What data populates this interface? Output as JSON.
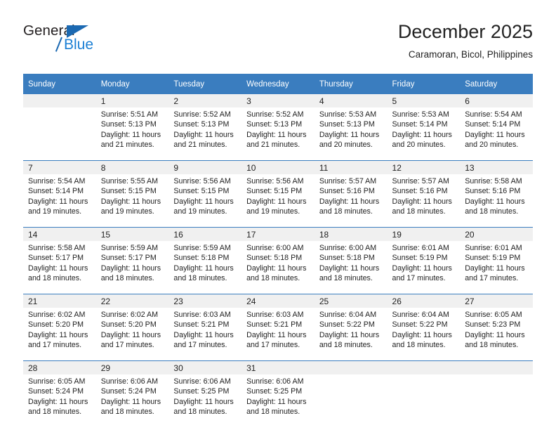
{
  "logo": {
    "text_primary": "General",
    "text_secondary": "Blue",
    "primary_color": "#231f20",
    "secondary_color": "#1b7fd4",
    "triangle_color": "#1b69b2"
  },
  "header": {
    "title": "December 2025",
    "subtitle": "Caramoran, Bicol, Philippines"
  },
  "calendar": {
    "header_bg": "#3a7dbf",
    "day_row_bg": "#f0f0f0",
    "weekdays": [
      "Sunday",
      "Monday",
      "Tuesday",
      "Wednesday",
      "Thursday",
      "Friday",
      "Saturday"
    ],
    "weeks": [
      [
        {
          "day": ""
        },
        {
          "day": "1",
          "sunrise": "Sunrise: 5:51 AM",
          "sunset": "Sunset: 5:13 PM",
          "daylight": "Daylight: 11 hours and 21 minutes."
        },
        {
          "day": "2",
          "sunrise": "Sunrise: 5:52 AM",
          "sunset": "Sunset: 5:13 PM",
          "daylight": "Daylight: 11 hours and 21 minutes."
        },
        {
          "day": "3",
          "sunrise": "Sunrise: 5:52 AM",
          "sunset": "Sunset: 5:13 PM",
          "daylight": "Daylight: 11 hours and 21 minutes."
        },
        {
          "day": "4",
          "sunrise": "Sunrise: 5:53 AM",
          "sunset": "Sunset: 5:13 PM",
          "daylight": "Daylight: 11 hours and 20 minutes."
        },
        {
          "day": "5",
          "sunrise": "Sunrise: 5:53 AM",
          "sunset": "Sunset: 5:14 PM",
          "daylight": "Daylight: 11 hours and 20 minutes."
        },
        {
          "day": "6",
          "sunrise": "Sunrise: 5:54 AM",
          "sunset": "Sunset: 5:14 PM",
          "daylight": "Daylight: 11 hours and 20 minutes."
        }
      ],
      [
        {
          "day": "7",
          "sunrise": "Sunrise: 5:54 AM",
          "sunset": "Sunset: 5:14 PM",
          "daylight": "Daylight: 11 hours and 19 minutes."
        },
        {
          "day": "8",
          "sunrise": "Sunrise: 5:55 AM",
          "sunset": "Sunset: 5:15 PM",
          "daylight": "Daylight: 11 hours and 19 minutes."
        },
        {
          "day": "9",
          "sunrise": "Sunrise: 5:56 AM",
          "sunset": "Sunset: 5:15 PM",
          "daylight": "Daylight: 11 hours and 19 minutes."
        },
        {
          "day": "10",
          "sunrise": "Sunrise: 5:56 AM",
          "sunset": "Sunset: 5:15 PM",
          "daylight": "Daylight: 11 hours and 19 minutes."
        },
        {
          "day": "11",
          "sunrise": "Sunrise: 5:57 AM",
          "sunset": "Sunset: 5:16 PM",
          "daylight": "Daylight: 11 hours and 18 minutes."
        },
        {
          "day": "12",
          "sunrise": "Sunrise: 5:57 AM",
          "sunset": "Sunset: 5:16 PM",
          "daylight": "Daylight: 11 hours and 18 minutes."
        },
        {
          "day": "13",
          "sunrise": "Sunrise: 5:58 AM",
          "sunset": "Sunset: 5:16 PM",
          "daylight": "Daylight: 11 hours and 18 minutes."
        }
      ],
      [
        {
          "day": "14",
          "sunrise": "Sunrise: 5:58 AM",
          "sunset": "Sunset: 5:17 PM",
          "daylight": "Daylight: 11 hours and 18 minutes."
        },
        {
          "day": "15",
          "sunrise": "Sunrise: 5:59 AM",
          "sunset": "Sunset: 5:17 PM",
          "daylight": "Daylight: 11 hours and 18 minutes."
        },
        {
          "day": "16",
          "sunrise": "Sunrise: 5:59 AM",
          "sunset": "Sunset: 5:18 PM",
          "daylight": "Daylight: 11 hours and 18 minutes."
        },
        {
          "day": "17",
          "sunrise": "Sunrise: 6:00 AM",
          "sunset": "Sunset: 5:18 PM",
          "daylight": "Daylight: 11 hours and 18 minutes."
        },
        {
          "day": "18",
          "sunrise": "Sunrise: 6:00 AM",
          "sunset": "Sunset: 5:18 PM",
          "daylight": "Daylight: 11 hours and 18 minutes."
        },
        {
          "day": "19",
          "sunrise": "Sunrise: 6:01 AM",
          "sunset": "Sunset: 5:19 PM",
          "daylight": "Daylight: 11 hours and 17 minutes."
        },
        {
          "day": "20",
          "sunrise": "Sunrise: 6:01 AM",
          "sunset": "Sunset: 5:19 PM",
          "daylight": "Daylight: 11 hours and 17 minutes."
        }
      ],
      [
        {
          "day": "21",
          "sunrise": "Sunrise: 6:02 AM",
          "sunset": "Sunset: 5:20 PM",
          "daylight": "Daylight: 11 hours and 17 minutes."
        },
        {
          "day": "22",
          "sunrise": "Sunrise: 6:02 AM",
          "sunset": "Sunset: 5:20 PM",
          "daylight": "Daylight: 11 hours and 17 minutes."
        },
        {
          "day": "23",
          "sunrise": "Sunrise: 6:03 AM",
          "sunset": "Sunset: 5:21 PM",
          "daylight": "Daylight: 11 hours and 17 minutes."
        },
        {
          "day": "24",
          "sunrise": "Sunrise: 6:03 AM",
          "sunset": "Sunset: 5:21 PM",
          "daylight": "Daylight: 11 hours and 17 minutes."
        },
        {
          "day": "25",
          "sunrise": "Sunrise: 6:04 AM",
          "sunset": "Sunset: 5:22 PM",
          "daylight": "Daylight: 11 hours and 18 minutes."
        },
        {
          "day": "26",
          "sunrise": "Sunrise: 6:04 AM",
          "sunset": "Sunset: 5:22 PM",
          "daylight": "Daylight: 11 hours and 18 minutes."
        },
        {
          "day": "27",
          "sunrise": "Sunrise: 6:05 AM",
          "sunset": "Sunset: 5:23 PM",
          "daylight": "Daylight: 11 hours and 18 minutes."
        }
      ],
      [
        {
          "day": "28",
          "sunrise": "Sunrise: 6:05 AM",
          "sunset": "Sunset: 5:24 PM",
          "daylight": "Daylight: 11 hours and 18 minutes."
        },
        {
          "day": "29",
          "sunrise": "Sunrise: 6:06 AM",
          "sunset": "Sunset: 5:24 PM",
          "daylight": "Daylight: 11 hours and 18 minutes."
        },
        {
          "day": "30",
          "sunrise": "Sunrise: 6:06 AM",
          "sunset": "Sunset: 5:25 PM",
          "daylight": "Daylight: 11 hours and 18 minutes."
        },
        {
          "day": "31",
          "sunrise": "Sunrise: 6:06 AM",
          "sunset": "Sunset: 5:25 PM",
          "daylight": "Daylight: 11 hours and 18 minutes."
        },
        {
          "day": ""
        },
        {
          "day": ""
        },
        {
          "day": ""
        }
      ]
    ]
  }
}
